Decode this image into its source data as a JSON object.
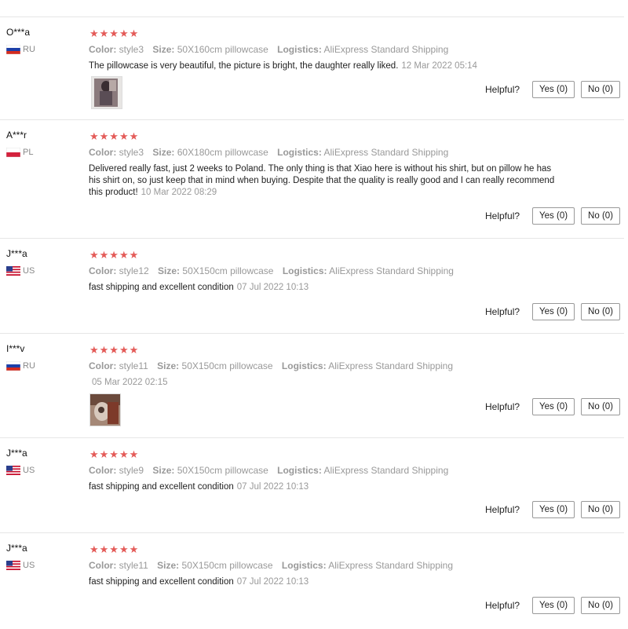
{
  "helpful_label": "Helpful?",
  "reviews": [
    {
      "name": "O***a",
      "country": "RU",
      "stars": "★★★★★",
      "color_label": "Color:",
      "color": "style3",
      "size_label": "Size:",
      "size": "50X160cm pillowcase",
      "logistics_label": "Logistics:",
      "logistics": "AliExpress Standard Shipping",
      "text": "The pillowcase is very beautiful, the picture is bright, the daughter really liked.",
      "date": "12 Mar 2022 05:14",
      "yes": "Yes (0)",
      "no": "No (0)"
    },
    {
      "name": "A***r",
      "country": "PL",
      "stars": "★★★★★",
      "color_label": "Color:",
      "color": "style3",
      "size_label": "Size:",
      "size": "60X180cm pillowcase",
      "logistics_label": "Logistics:",
      "logistics": "AliExpress Standard Shipping",
      "text": "Delivered really fast, just 2 weeks to Poland. The only thing is that Xiao here is without his shirt, but on pillow he has his shirt on, so just keep that in mind when buying. Despite that the quality is really good and I can really recommend this product!",
      "date": "10 Mar 2022 08:29",
      "yes": "Yes (0)",
      "no": "No (0)"
    },
    {
      "name": "J***a",
      "country": "US",
      "stars": "★★★★★",
      "color_label": "Color:",
      "color": "style12",
      "size_label": "Size:",
      "size": "50X150cm pillowcase",
      "logistics_label": "Logistics:",
      "logistics": "AliExpress Standard Shipping",
      "text": "fast shipping and excellent condition",
      "date": "07 Jul 2022 10:13",
      "yes": "Yes (0)",
      "no": "No (0)"
    },
    {
      "name": "I***v",
      "country": "RU",
      "stars": "★★★★★",
      "color_label": "Color:",
      "color": "style11",
      "size_label": "Size:",
      "size": "50X150cm pillowcase",
      "logistics_label": "Logistics:",
      "logistics": "AliExpress Standard Shipping",
      "text": "",
      "date": "05 Mar 2022 02:15",
      "yes": "Yes (0)",
      "no": "No (0)"
    },
    {
      "name": "J***a",
      "country": "US",
      "stars": "★★★★★",
      "color_label": "Color:",
      "color": "style9",
      "size_label": "Size:",
      "size": "50X150cm pillowcase",
      "logistics_label": "Logistics:",
      "logistics": "AliExpress Standard Shipping",
      "text": "fast shipping and excellent condition",
      "date": "07 Jul 2022 10:13",
      "yes": "Yes (0)",
      "no": "No (0)"
    },
    {
      "name": "J***a",
      "country": "US",
      "stars": "★★★★★",
      "color_label": "Color:",
      "color": "style11",
      "size_label": "Size:",
      "size": "50X150cm pillowcase",
      "logistics_label": "Logistics:",
      "logistics": "AliExpress Standard Shipping",
      "text": "fast shipping and excellent condition",
      "date": "07 Jul 2022 10:13",
      "yes": "Yes (0)",
      "no": "No (0)"
    }
  ]
}
